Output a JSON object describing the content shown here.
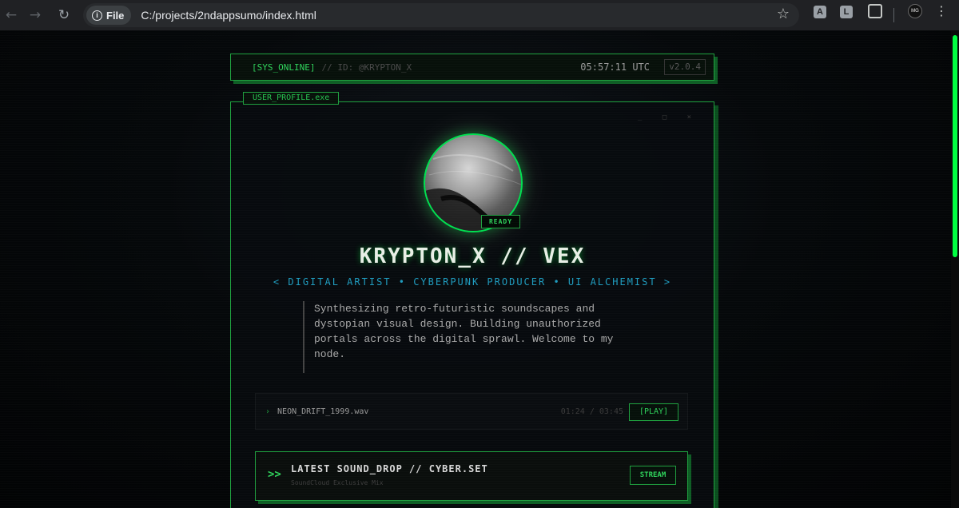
{
  "browser": {
    "back_icon": "arrow-left-icon",
    "forward_icon": "arrow-right-icon",
    "reload_icon": "reload-icon",
    "file_label": "File",
    "url": "C:/projects/2ndappsumo/index.html",
    "extensions": [
      "A",
      "L"
    ],
    "avatar_initials": "MG"
  },
  "header": {
    "status": "[SYS_ONLINE]",
    "id": "// ID: @KRYPTON_X",
    "time": "05:57:11 UTC",
    "version": "v2.0.4"
  },
  "profile": {
    "tab_label": "USER_PROFILE.exe",
    "window_controls": "_ □ ×",
    "status_badge": "READY",
    "name": "KRYPTON_X // VEX",
    "roles": "< DIGITAL ARTIST • CYBERPUNK PRODUCER • UI ALCHEMIST >",
    "bio": "Synthesizing retro-futuristic soundscapes and dystopian visual design. Building unauthorized portals across the digital sprawl. Welcome to my node."
  },
  "player": {
    "icon": "play-triangle-icon",
    "track": "NEON_DRIFT_1999.wav",
    "time": "01:24 / 03:45",
    "play_label": "[PLAY]"
  },
  "drop": {
    "arrows": ">>",
    "title": "LATEST SOUND_DROP // CYBER.SET",
    "subtitle": "SoundCloud Exclusive Mix",
    "button_label": "STREAM"
  },
  "colors": {
    "accent": "#00ff41",
    "border": "#1fa03f",
    "roles": "#1f9cbf",
    "background": "#05080a"
  }
}
